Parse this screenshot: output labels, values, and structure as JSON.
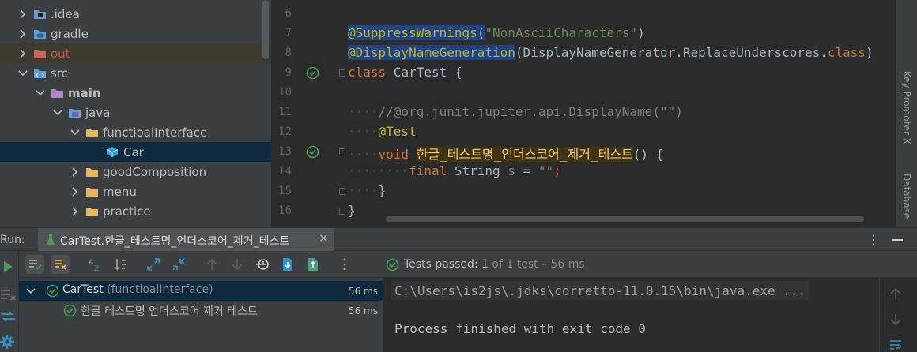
{
  "project_tree": {
    "items": [
      {
        "label": ".idea",
        "icon": "idea-folder-icon",
        "expanded": false
      },
      {
        "label": "gradle",
        "icon": "gradle-folder-icon",
        "expanded": false
      },
      {
        "label": "out",
        "icon": "excluded-folder-icon",
        "expanded": false
      },
      {
        "label": "src",
        "icon": "source-folder-icon",
        "expanded": true
      },
      {
        "label": "main",
        "icon": "module-folder-icon",
        "expanded": true
      },
      {
        "label": "java",
        "icon": "java-source-folder-icon",
        "expanded": true
      },
      {
        "label": "functioalInterface",
        "icon": "package-folder-icon",
        "expanded": true
      },
      {
        "label": "Car",
        "icon": "class-icon",
        "selected": true
      },
      {
        "label": "goodComposition",
        "icon": "package-folder-icon",
        "expanded": false
      },
      {
        "label": "menu",
        "icon": "package-folder-icon",
        "expanded": false
      },
      {
        "label": "practice",
        "icon": "package-folder-icon",
        "expanded": false
      }
    ]
  },
  "editor": {
    "line_numbers": [
      "6",
      "7",
      "8",
      "9",
      "10",
      "11",
      "12",
      "13",
      "14",
      "15",
      "16"
    ],
    "lines": {
      "l7_ann": "@SuppressWarnings",
      "l7_paren_open": "(",
      "l7_str": "\"NonAsciiCharacters\"",
      "l7_paren_close": ")",
      "l8_ann": "@DisplayNameGeneration",
      "l8_rest": "(DisplayNameGenerator.ReplaceUnderscores.",
      "l8_kw": "class",
      "l8_close": ")",
      "l9_kw": "class",
      "l9_rest": " CarTest {",
      "l11_dots": "····",
      "l11_comment": "//@org.junit.jupiter.api.DisplayName(\"\")",
      "l12_dots": "····",
      "l12_ann": "@Test",
      "l13_dots": "····",
      "l13_kw": "void",
      "l13_name": "한글_테스트명_언더스코어_제거_테스트",
      "l13_rest": "() {",
      "l14_dots": "········",
      "l14_kw": "final",
      "l14_type": "String",
      "l14_var": "s",
      "l14_eq": " = ",
      "l14_str": "\"\"",
      "l14_semi": ";",
      "l15_dots": "····",
      "l15_brace": "}",
      "l16_brace": "}"
    },
    "right_panel_label": "Key Promoter X",
    "right_panel_label2": "Database"
  },
  "run_window": {
    "run_label": "Run:",
    "tab_title": "CarTest.한글_테스트명_언더스코어_제거_테스트",
    "tab_close": "✕",
    "more_icon": "⋮",
    "status": {
      "passed_label": "Tests passed: ",
      "passed_count": "1",
      "of_total": " of 1 test",
      "duration": " – 56 ms"
    },
    "tests": [
      {
        "name": "CarTest",
        "package": " (functioalInterface)",
        "time": "56 ms"
      },
      {
        "name": "한글 테스트명 언더스코어 제거 테스트",
        "time": "56 ms"
      }
    ],
    "console": {
      "command": "C:\\Users\\is2js\\.jdks\\corretto-11.0.15\\bin\\java.exe ...",
      "exit": "Process finished with exit code 0"
    }
  },
  "colors": {
    "background": "#2b2b2b",
    "panel": "#3c3f41",
    "selection": "#0d293e",
    "annotation": "#bbb529",
    "keyword": "#cc7832",
    "string": "#6a8759",
    "method": "#ffc66d",
    "pass": "#499c54"
  }
}
